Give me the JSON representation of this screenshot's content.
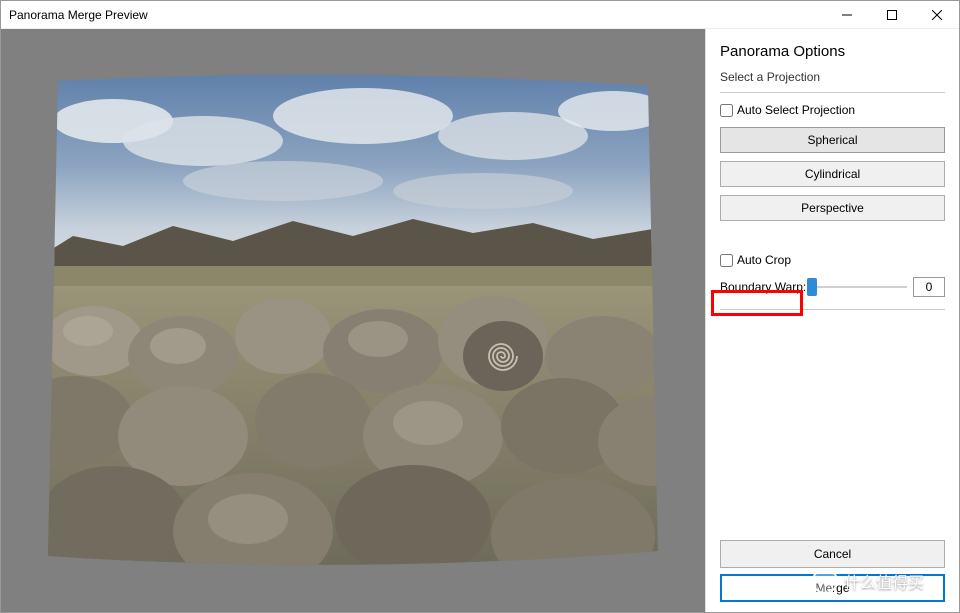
{
  "title": "Panorama Merge Preview",
  "panel": {
    "heading": "Panorama Options",
    "subheading": "Select a Projection",
    "auto_select_label": "Auto Select Projection",
    "projections": [
      "Spherical",
      "Cylindrical",
      "Perspective"
    ],
    "auto_crop_label": "Auto Crop",
    "boundary_warp_label": "Boundary Warp:",
    "boundary_warp_value": "0"
  },
  "actions": {
    "cancel": "Cancel",
    "merge": "Merge"
  },
  "watermark": "什么值得买"
}
